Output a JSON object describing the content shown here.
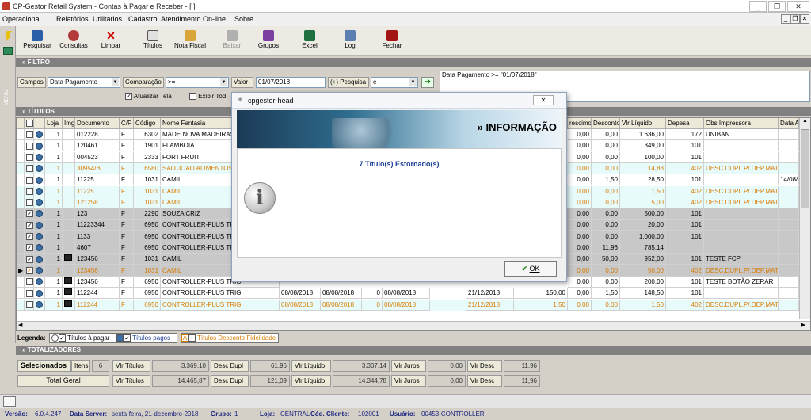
{
  "window": {
    "title": "CP-Gestor Retail System - Contas à Pagar e Receber - [ ]",
    "controls": [
      "_",
      "❐",
      "✕"
    ],
    "child_controls": [
      "_",
      "❐",
      "✕"
    ]
  },
  "menu": [
    "Operacional",
    "Relatórios",
    "Utilitários",
    "Cadastro",
    "Atendimento On-line",
    "Sobre"
  ],
  "side_label": "MENU",
  "toolbar": [
    {
      "label": "Pesquisar",
      "icon": "search-icon",
      "enabled": true
    },
    {
      "label": "Consultas",
      "icon": "consult-icon",
      "enabled": true
    },
    {
      "label": "Limpar",
      "icon": "clear-icon",
      "enabled": true
    },
    {
      "label": "Títulos",
      "icon": "titles-icon",
      "enabled": true
    },
    {
      "label": "Nota Fiscal",
      "icon": "invoice-icon",
      "enabled": true
    },
    {
      "label": "Baixar",
      "icon": "download-icon",
      "enabled": false
    },
    {
      "label": "Grupos",
      "icon": "groups-icon",
      "enabled": true
    },
    {
      "label": "Excel",
      "icon": "excel-icon",
      "enabled": true
    },
    {
      "label": "Log",
      "icon": "log-icon",
      "enabled": true
    },
    {
      "label": "Fechar",
      "icon": "close-icon",
      "enabled": true
    }
  ],
  "filtro": {
    "section": "» FILTRO",
    "campos_label": "Campos",
    "campos_value": "Data Pagamento",
    "comparacao_label": "Comparação",
    "comparacao_value": ">=",
    "valor_label": "Valor",
    "valor_value": "01/07/2018",
    "pesquisa_label": "(+) Pesquisa",
    "pesquisa_value": "e",
    "atualizar_label": "Atualizar Tela",
    "exibir_label": "Exibir Tod",
    "expression": "Data Pagamento >= \"01/07/2018\""
  },
  "titulos": {
    "section": "» TÍTULOS",
    "columns": [
      "Loja",
      "Img",
      "Documento",
      "C/F",
      "Código",
      "Nome Fantasia",
      "rescimo",
      "Desconto",
      "Vlr Líquido",
      "Depesa",
      "Obs Impressora",
      "Data A"
    ],
    "rows": [
      {
        "chk": false,
        "loja": "1",
        "img": false,
        "doc": "012228",
        "cf": "F",
        "cod": "6302",
        "nome": "MADE NOVA MADEIRAS",
        "acr": "0,00",
        "desc": "0,00",
        "liq": "1.636,00",
        "dep": "172",
        "obs": "UNIBAN",
        "dt": "",
        "style": "white"
      },
      {
        "chk": false,
        "loja": "1",
        "img": false,
        "doc": "120461",
        "cf": "F",
        "cod": "1901",
        "nome": "FLAMBOIA",
        "acr": "0,00",
        "desc": "0,00",
        "liq": "349,00",
        "dep": "101",
        "obs": "",
        "dt": "",
        "style": "white"
      },
      {
        "chk": false,
        "loja": "1",
        "img": false,
        "doc": "004523",
        "cf": "F",
        "cod": "2333",
        "nome": "FORT FRUIT",
        "acr": "0,00",
        "desc": "0,00",
        "liq": "100,00",
        "dep": "101",
        "obs": "",
        "dt": "",
        "style": "white"
      },
      {
        "chk": false,
        "loja": "1",
        "img": false,
        "doc": "30954/B",
        "cf": "F",
        "cod": "6580",
        "nome": "SAO JOAO ALIMENTOS",
        "acr": "0,00",
        "desc": "0,00",
        "liq": "14,83",
        "dep": "402",
        "obs": "DESC.DUPL.P/.DEP.MAT",
        "dt": "",
        "style": "orange"
      },
      {
        "chk": false,
        "loja": "1",
        "img": false,
        "doc": "11225",
        "cf": "F",
        "cod": "1031",
        "nome": "CAMIL",
        "acr": "0,00",
        "desc": "1,50",
        "liq": "28,50",
        "dep": "101",
        "obs": "",
        "dt": "14/08/",
        "style": "white"
      },
      {
        "chk": false,
        "loja": "1",
        "img": false,
        "doc": "11225",
        "cf": "F",
        "cod": "1031",
        "nome": "CAMIL",
        "acr": "0,00",
        "desc": "0,00",
        "liq": "1,50",
        "dep": "402",
        "obs": "DESC.DUPL.P/.DEP.MAT",
        "dt": "",
        "style": "orange"
      },
      {
        "chk": false,
        "loja": "1",
        "img": false,
        "doc": "121258",
        "cf": "F",
        "cod": "1031",
        "nome": "CAMIL",
        "acr": "0,00",
        "desc": "0,00",
        "liq": "5,00",
        "dep": "402",
        "obs": "DESC.DUPL.P/.DEP.MAT",
        "dt": "",
        "style": "orange"
      },
      {
        "chk": true,
        "loja": "1",
        "img": false,
        "doc": "123",
        "cf": "F",
        "cod": "2290",
        "nome": "SOUZA CRIZ",
        "acr": "0,00",
        "desc": "0,00",
        "liq": "500,00",
        "dep": "101",
        "obs": "",
        "dt": "",
        "style": "gray"
      },
      {
        "chk": true,
        "loja": "1",
        "img": false,
        "doc": "11223344",
        "cf": "F",
        "cod": "6950",
        "nome": "CONTROLLER-PLUS TRIG",
        "acr": "0,00",
        "desc": "0,00",
        "liq": "20,00",
        "dep": "101",
        "obs": "",
        "dt": "",
        "style": "gray"
      },
      {
        "chk": true,
        "loja": "1",
        "img": false,
        "doc": "1133",
        "cf": "F",
        "cod": "6950",
        "nome": "CONTROLLER-PLUS TRIG",
        "acr": "0,00",
        "desc": "0,00",
        "liq": "1.000,00",
        "dep": "101",
        "obs": "",
        "dt": "",
        "style": "gray"
      },
      {
        "chk": true,
        "loja": "1",
        "img": false,
        "doc": "4607",
        "cf": "F",
        "cod": "6950",
        "nome": "CONTROLLER-PLUS TRIG",
        "acr": "0,00",
        "desc": "11,96",
        "liq": "785,14",
        "dep": "",
        "obs": "",
        "dt": "",
        "style": "gray"
      },
      {
        "chk": true,
        "loja": "1",
        "img": true,
        "doc": "123456",
        "cf": "F",
        "cod": "1031",
        "nome": "CAMIL",
        "acr": "0,00",
        "desc": "50,00",
        "liq": "952,00",
        "dep": "101",
        "obs": "TESTE FCP",
        "dt": "",
        "style": "gray"
      },
      {
        "chk": true,
        "loja": "1",
        "img": false,
        "doc": "123456",
        "cf": "F",
        "cod": "1031",
        "nome": "CAMIL",
        "acr": "0,00",
        "desc": "0,00",
        "liq": "50,00",
        "dep": "402",
        "obs": "DESC.DUPL.P/.DEP.MAT",
        "dt": "",
        "style": "grayorange",
        "current": true
      },
      {
        "chk": false,
        "loja": "1",
        "img": true,
        "doc": "123456",
        "cf": "F",
        "cod": "6950",
        "nome": "CONTROLLER-PLUS TRIG",
        "acr": "0,00",
        "desc": "0,00",
        "liq": "200,00",
        "dep": "101",
        "obs": "TESTE BOTÃO ZERAR",
        "dt": "",
        "style": "white"
      },
      {
        "chk": false,
        "loja": "1",
        "img": true,
        "doc": "112244",
        "cf": "F",
        "cod": "6950",
        "nome": "CONTROLLER-PLUS TRIG",
        "acr": "0,00",
        "desc": "1,50",
        "liq": "148,50",
        "dep": "101",
        "obs": "",
        "dt": "",
        "style": "white",
        "extra": [
          "08/08/2018",
          "08/08/2018",
          "0",
          "08/08/2018",
          "21/12/2018",
          "150,00"
        ]
      },
      {
        "chk": false,
        "loja": "1",
        "img": true,
        "doc": "112244",
        "cf": "F",
        "cod": "6950",
        "nome": "CONTROLLER-PLUS TRIG",
        "acr": "0,00",
        "desc": "0,00",
        "liq": "1,50",
        "dep": "402",
        "obs": "DESC.DUPL.P/.DEP.MAT",
        "dt": "",
        "style": "orange",
        "extra": [
          "08/08/2018",
          "08/08/2018",
          "0",
          "08/08/2018",
          "21/12/2018",
          "1,50"
        ]
      }
    ]
  },
  "legend": {
    "title": "Legenda:",
    "items": [
      "Títulos à pagar",
      "Títulos pagos",
      "Títulos Desconto Fidelidade"
    ]
  },
  "totalizadores": {
    "section": "» TOTALIZADORES",
    "selecionados": {
      "label": "Selecionados",
      "itens_label": "Itens",
      "itens": "6",
      "vlr_titulos": "3.369,10",
      "desc_dupl": "61,96",
      "vlr_liquido": "3.307,14",
      "vlr_juros": "0,00",
      "vlr_desc": "11,96"
    },
    "total": {
      "label": "Total Geral",
      "vlr_titulos": "14.465,87",
      "desc_dupl": "121,09",
      "vlr_liquido": "14.344,78",
      "vlr_juros": "0,00",
      "vlr_desc": "11,96"
    },
    "labels": {
      "vlr_titulos": "Vlr Títulos",
      "desc_dupl": "Desc Dupl",
      "vlr_liquido": "Vlr Líquido",
      "vlr_juros": "Vlr Juros",
      "vlr_desc": "Vlr Desc"
    }
  },
  "status": {
    "versao_label": "Versão:",
    "versao": "6.0.4.247",
    "server_label": "Data Server:",
    "server": "sexta-feira, 21-dezembro-2018",
    "grupo_label": "Grupo:",
    "grupo": "1",
    "loja_label": "Loja:",
    "loja": "CENTRAL",
    "cliente_label": "Cód. Cliente:",
    "cliente": "102001",
    "usuario_label": "Usuário:",
    "usuario": "00453-CONTROLLER"
  },
  "dialog": {
    "title": "cpgestor-head",
    "banner": "» INFORMAÇÃO",
    "message": "7 Título(s) Estornado(s)",
    "ok": "OK",
    "close": "✕"
  },
  "colors": {
    "accent": "#1c3f95",
    "orange": "#d97a00",
    "gray_row": "#c8c8c8",
    "cyan_row": "#e8fbfb"
  }
}
